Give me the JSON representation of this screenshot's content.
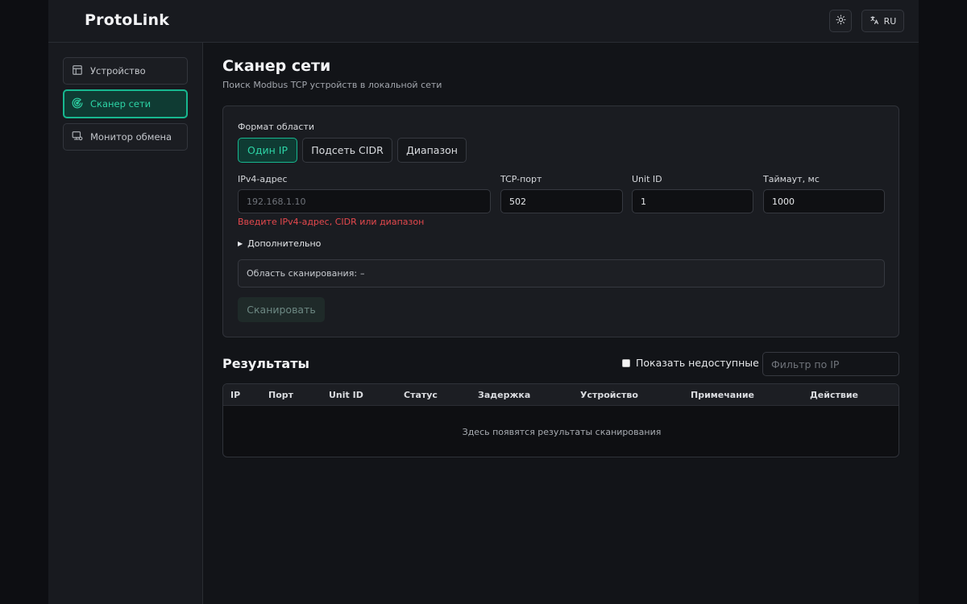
{
  "header": {
    "brand": "ProtoLink",
    "theme_icon": "sun-icon",
    "language_icon": "translate-icon",
    "language": "RU"
  },
  "sidebar": {
    "items": [
      {
        "label": "Устройство",
        "icon": "device-panel-icon",
        "active": false
      },
      {
        "label": "Сканер сети",
        "icon": "radar-icon",
        "active": true
      },
      {
        "label": "Монитор обмена",
        "icon": "monitor-icon",
        "active": false
      }
    ]
  },
  "page": {
    "title": "Сканер сети",
    "subtitle": "Поиск Modbus TCP устройств в локальной сети"
  },
  "scan_form": {
    "format_label": "Формат области",
    "formats": [
      {
        "label": "Один IP",
        "active": true
      },
      {
        "label": "Подсеть CIDR",
        "active": false
      },
      {
        "label": "Диапазон",
        "active": false
      }
    ],
    "ip_label": "IPv4-адрес",
    "ip_placeholder": "192.168.1.10",
    "ip_value": "",
    "port_label": "TCP-порт",
    "port_value": "502",
    "unit_label": "Unit ID",
    "unit_value": "1",
    "timeout_label": "Таймаут, мс",
    "timeout_value": "1000",
    "error": "Введите IPv4-адрес, CIDR или диапазон",
    "advanced_label": "Дополнительно",
    "scope_label": "Область сканирования:",
    "scope_value": "–",
    "scan_button": "Сканировать"
  },
  "results": {
    "title": "Результаты",
    "show_unreachable_label": "Показать недоступные",
    "show_unreachable_checked": false,
    "filter_placeholder": "Фильтр по IP",
    "columns": [
      "IP",
      "Порт",
      "Unit ID",
      "Статус",
      "Задержка",
      "Устройство",
      "Примечание",
      "Действие"
    ],
    "rows": [],
    "empty_text": "Здесь появятся результаты сканирования"
  },
  "colors": {
    "accent": "#17b890",
    "accent_text": "#2dd4a6",
    "error": "#e5484d",
    "background": "#121418"
  }
}
